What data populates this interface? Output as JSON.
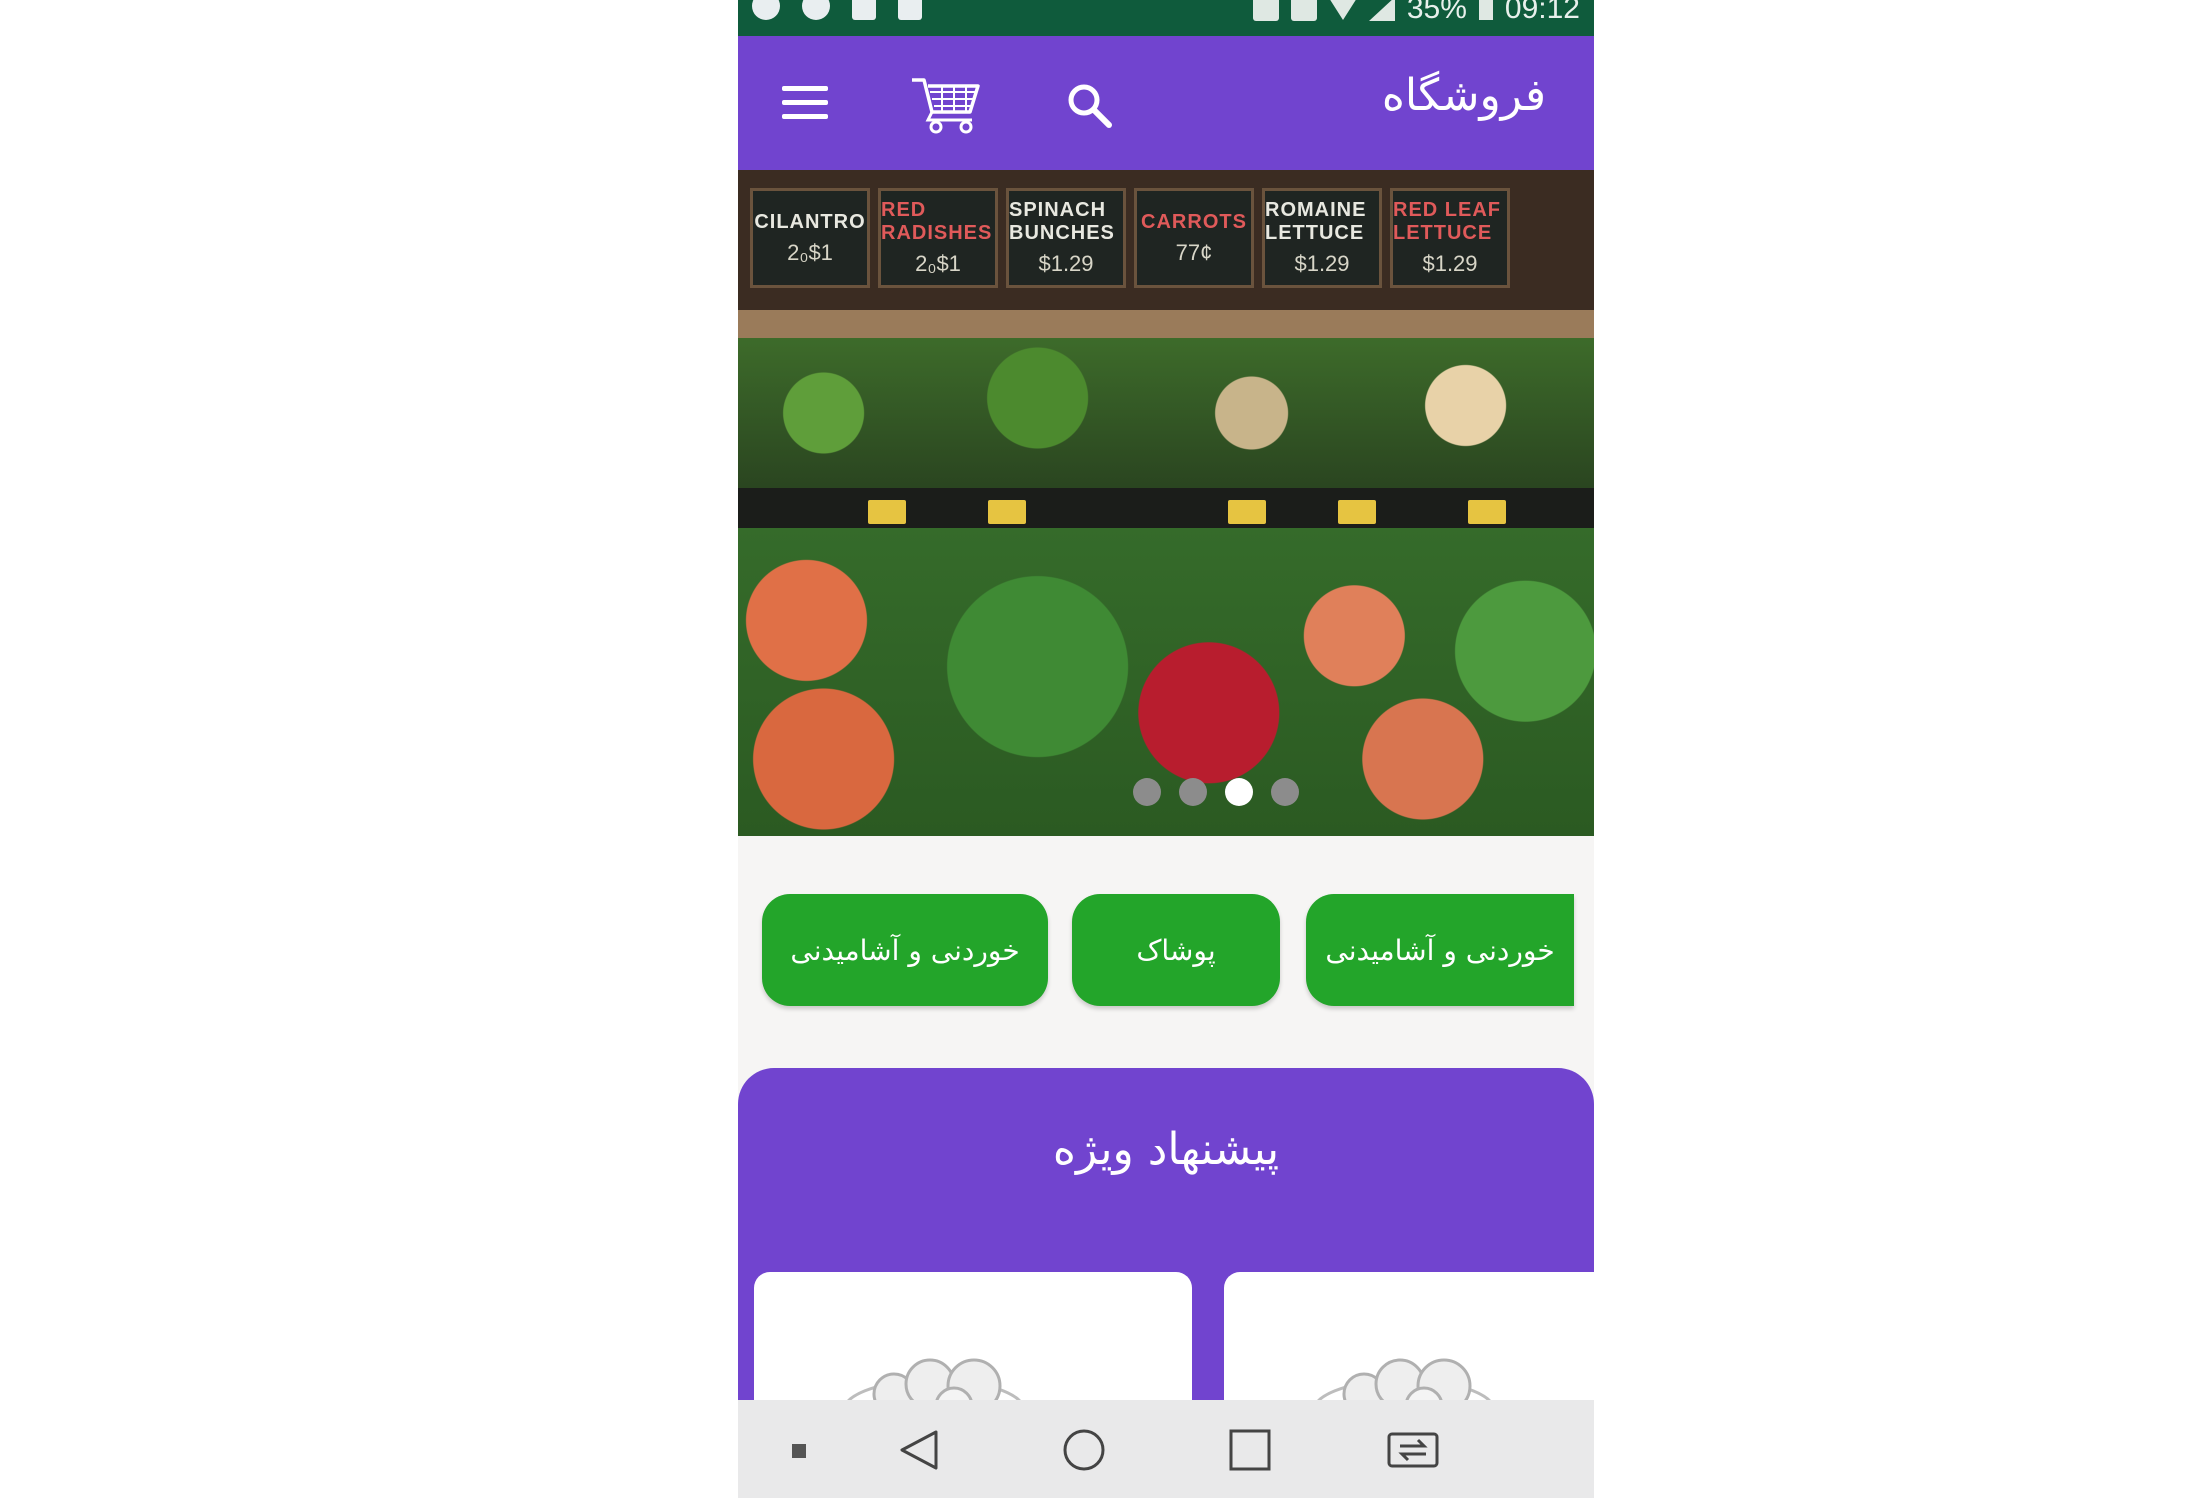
{
  "status_bar": {
    "battery": "35%",
    "time": "09:12",
    "left_icons": [
      "telegram-icon",
      "notification-badge-icon",
      "gallery-icon",
      "medical-icon"
    ],
    "right_icons": [
      "vibrate-icon",
      "vpn-key-icon",
      "wifi-icon",
      "signal-icon",
      "battery-icon"
    ]
  },
  "app_bar": {
    "title": "فروشگاه",
    "icons": [
      "menu-icon",
      "cart-icon",
      "search-icon"
    ],
    "color": "#7144cf"
  },
  "banner": {
    "signs": [
      {
        "name": "CILANTRO",
        "price": "2₀$1"
      },
      {
        "name": "RED RADISHES",
        "price": "2₀$1"
      },
      {
        "name": "SPINACH BUNCHES",
        "price": "$1.29"
      },
      {
        "name": "CARROTS",
        "price": "77¢"
      },
      {
        "name": "ROMAINE LETTUCE",
        "price": "$1.29"
      },
      {
        "name": "RED LEAF LETTUCE",
        "price": "$1.29"
      }
    ],
    "slides": 4,
    "active_slide": 3
  },
  "categories": [
    {
      "label": "خوردنی و آشامیدنی"
    },
    {
      "label": "پوشاک"
    },
    {
      "label": "خوردنی و آشامیدنی"
    }
  ],
  "special_offer": {
    "title": "پیشنهاد ویژه",
    "color": "#7144cf"
  },
  "colors": {
    "status_bar": "#0f5b3c",
    "accent_green": "#23a52a",
    "background": "#f6f5f4"
  },
  "nav_bar": {
    "icons": [
      "dot-square-icon",
      "back-icon",
      "home-icon",
      "recents-icon",
      "switch-app-icon"
    ]
  }
}
